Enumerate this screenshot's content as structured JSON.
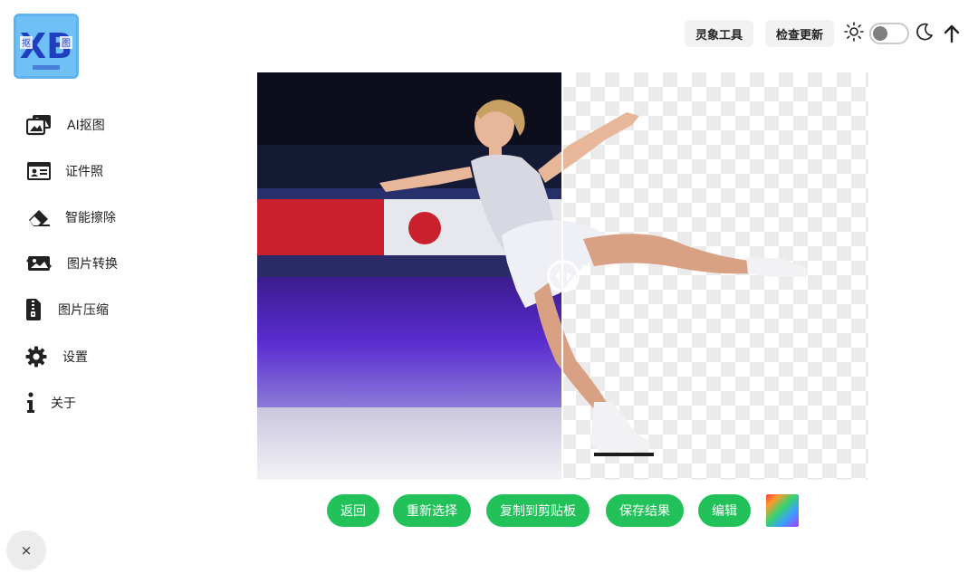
{
  "logo": {
    "letters": "XB",
    "left_char": "抠",
    "right_char": "图",
    "tagline": ""
  },
  "sidebar": {
    "items": [
      {
        "label": "AI抠图",
        "icon": "images-icon"
      },
      {
        "label": "证件照",
        "icon": "id-card-icon"
      },
      {
        "label": "智能擦除",
        "icon": "eraser-icon"
      },
      {
        "label": "图片转换",
        "icon": "image-convert-icon"
      },
      {
        "label": "图片压缩",
        "icon": "file-zip-icon"
      },
      {
        "label": "设置",
        "icon": "gear-icon"
      },
      {
        "label": "关于",
        "icon": "info-icon"
      }
    ]
  },
  "header": {
    "tool_label": "灵象工具",
    "update_label": "检查更新",
    "theme_toggle": {
      "state": "light"
    }
  },
  "compare": {
    "split_fraction": 0.5
  },
  "actions": {
    "back": "返回",
    "reselect": "重新选择",
    "copy": "复制到剪贴板",
    "save": "保存结果",
    "edit": "编辑"
  },
  "close": {
    "label": "×"
  },
  "colors": {
    "accent": "#22c15a",
    "logo_bg": "#6ec0f6",
    "logo_letter": "#1f3fbf"
  }
}
